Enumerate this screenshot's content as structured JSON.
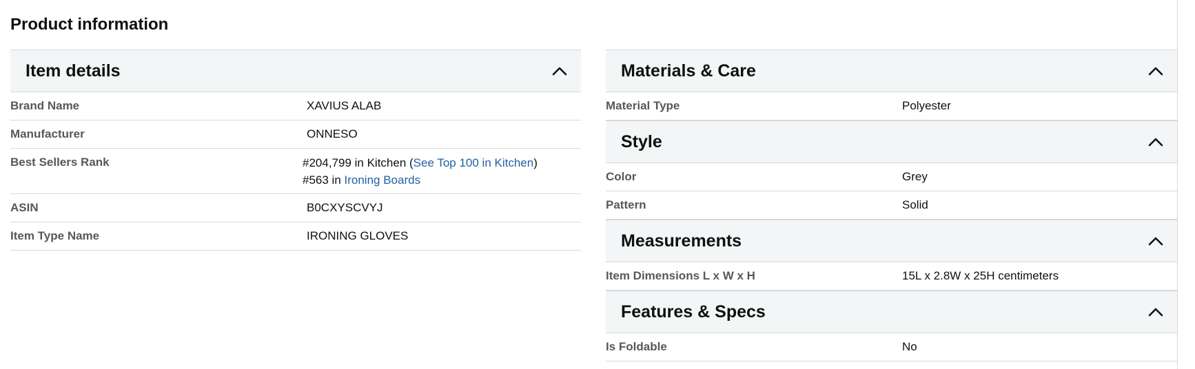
{
  "page_title": "Product information",
  "colors": {
    "link": "#2162a1",
    "header_bg": "#f3f5f6",
    "divider": "#d5d9d9",
    "label": "#565959"
  },
  "item_details": {
    "title": "Item details",
    "toggle_icon": "chevron-up-icon",
    "brand_label": "Brand Name",
    "brand_value": "XAVIUS ALAB",
    "manufacturer_label": "Manufacturer",
    "manufacturer_value": "ONNESO",
    "rank_label": "Best Sellers Rank",
    "rank1_text": "#204,799 in Kitchen (",
    "rank1_link": "See Top 100 in Kitchen",
    "rank1_close": ")",
    "rank2_text": "#563 in ",
    "rank2_link": "Ironing Boards",
    "asin_label": "ASIN",
    "asin_value": "B0CXYSCVYJ",
    "item_type_label": "Item Type Name",
    "item_type_value": "IRONING GLOVES"
  },
  "materials_care": {
    "title": "Materials & Care",
    "material_label": "Material Type",
    "material_value": "Polyester"
  },
  "style": {
    "title": "Style",
    "color_label": "Color",
    "color_value": "Grey",
    "pattern_label": "Pattern",
    "pattern_value": "Solid"
  },
  "measurements": {
    "title": "Measurements",
    "dimensions_label": "Item Dimensions L x W x H",
    "dimensions_value": "15L x 2.8W x 25H centimeters"
  },
  "features_specs": {
    "title": "Features & Specs",
    "foldable_label": "Is Foldable",
    "foldable_value": "No"
  }
}
